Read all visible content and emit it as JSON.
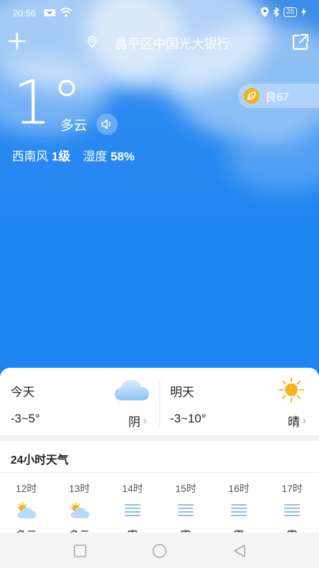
{
  "status": {
    "time": "20:56",
    "battery": "25"
  },
  "location": {
    "name": "昌平区中国光大银行"
  },
  "current": {
    "temperature": "1°",
    "condition": "多云",
    "aqi_label": "良67",
    "wind_label": "西南风",
    "wind_value": "1级",
    "humidity_label": "湿度",
    "humidity_value": "58%"
  },
  "forecast": {
    "today": {
      "name": "今天",
      "range": "-3~5°",
      "condition": "阴"
    },
    "tomorrow": {
      "name": "明天",
      "range": "-3~10°",
      "condition": "晴"
    }
  },
  "hourly": {
    "title": "24小时天气",
    "items": [
      {
        "time": "12时",
        "icon": "partly-cloudy-icon",
        "condition": "多云"
      },
      {
        "time": "13时",
        "icon": "partly-cloudy-icon",
        "condition": "多云"
      },
      {
        "time": "14时",
        "icon": "fog-icon",
        "condition": "雾"
      },
      {
        "time": "15时",
        "icon": "fog-icon",
        "condition": "雾"
      },
      {
        "time": "16时",
        "icon": "fog-icon",
        "condition": "雾"
      },
      {
        "time": "17时",
        "icon": "fog-icon",
        "condition": "雾"
      }
    ]
  },
  "colors": {
    "sky": "#1f86f0",
    "accent_sun": "#f5b51b",
    "aqi_dot": "#f3b31b"
  }
}
